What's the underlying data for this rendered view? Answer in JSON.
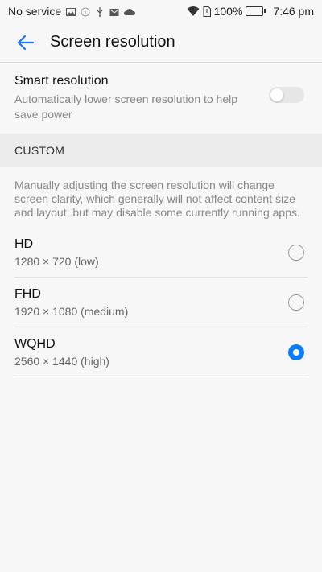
{
  "status_bar": {
    "carrier": "No service",
    "battery": "100%",
    "time": "7:46 pm"
  },
  "app_bar": {
    "title": "Screen resolution",
    "accent_color": "#1a73e8"
  },
  "smart_resolution": {
    "title": "Smart resolution",
    "description": "Automatically lower screen resolution to help save power",
    "enabled": false
  },
  "custom": {
    "header": "CUSTOM",
    "info": "Manually adjusting the screen resolution will change screen clarity, which generally will not affect content size and layout, but may disable some currently running apps."
  },
  "options": [
    {
      "title": "HD",
      "subtitle": "1280 × 720 (low)",
      "selected": false
    },
    {
      "title": "FHD",
      "subtitle": "1920 × 1080 (medium)",
      "selected": false
    },
    {
      "title": "WQHD",
      "subtitle": "2560 × 1440 (high)",
      "selected": true
    }
  ],
  "colors": {
    "selected_radio": "#0a7bff",
    "background": "#f7f7f7",
    "section_bg": "#ececec"
  }
}
